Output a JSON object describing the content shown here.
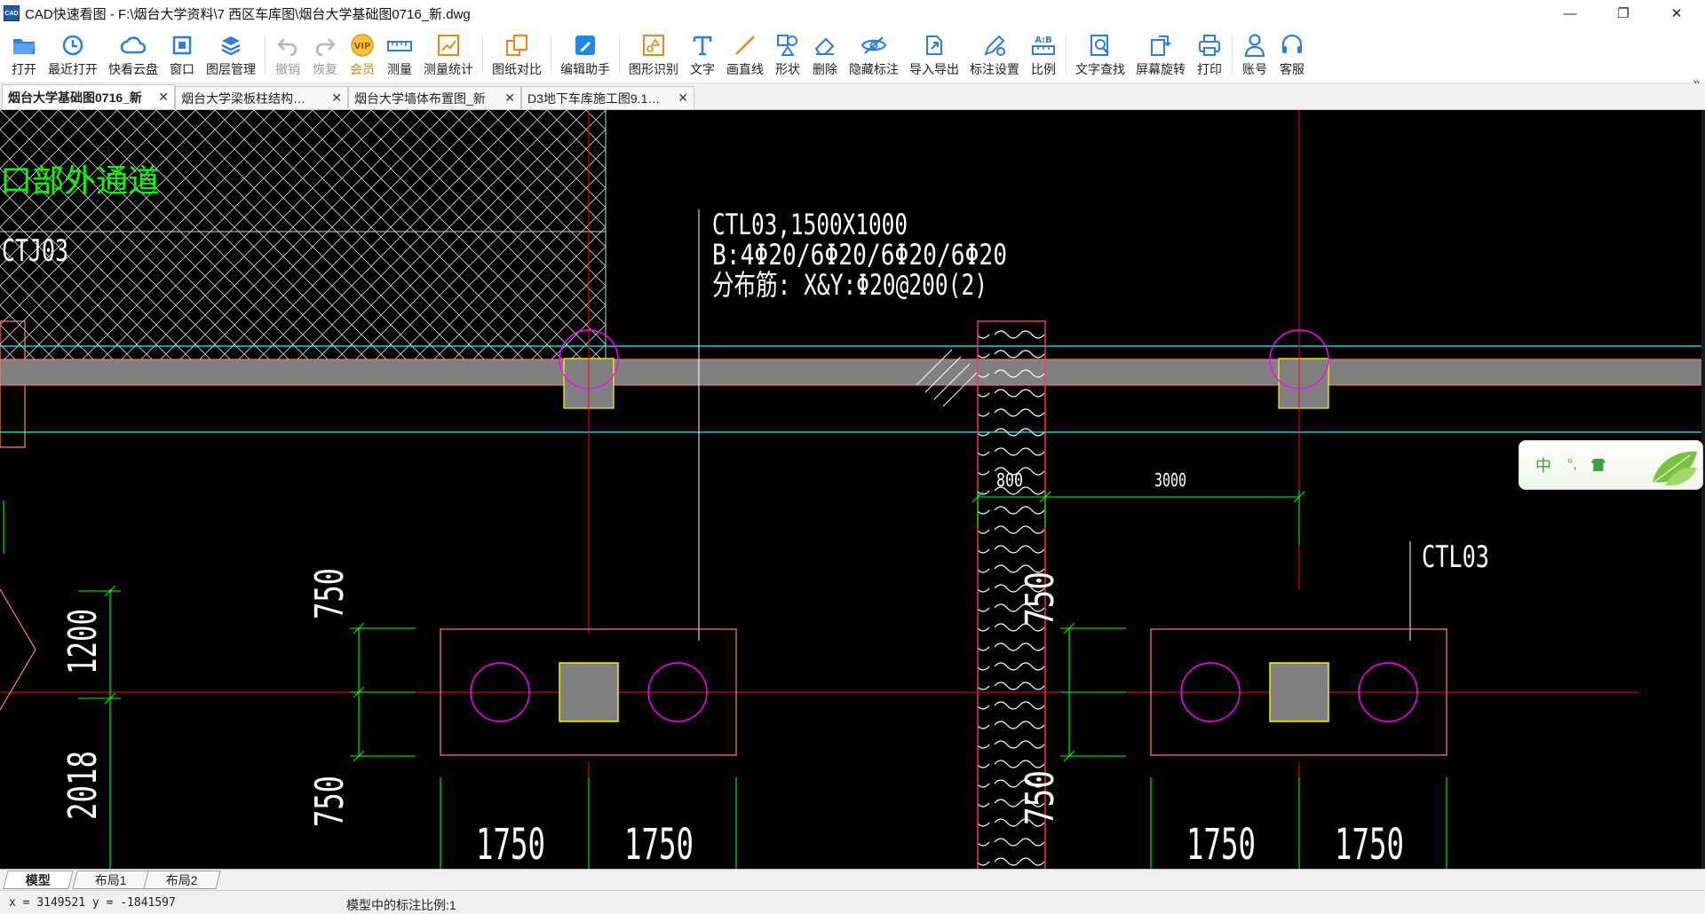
{
  "window": {
    "title": "CAD快速看图 - F:\\烟台大学资料\\7 西区车库图\\烟台大学基础图0716_新.dwg",
    "app_icon_text": "CAD",
    "minimize": "—",
    "restore": "❐",
    "close": "✕"
  },
  "toolbar": {
    "items": [
      {
        "label": "打开",
        "icon": "open-folder-icon"
      },
      {
        "label": "最近打开",
        "icon": "recent-clock-icon"
      },
      {
        "label": "快看云盘",
        "icon": "cloud-icon"
      },
      {
        "label": "窗口",
        "icon": "window-icon"
      },
      {
        "label": "图层管理",
        "icon": "layers-icon"
      },
      {
        "label": "撤销",
        "icon": "undo-icon"
      },
      {
        "label": "恢复",
        "icon": "redo-icon"
      },
      {
        "label": "会员",
        "icon": "vip-icon",
        "badge": "VIP"
      },
      {
        "label": "测量",
        "icon": "ruler-icon"
      },
      {
        "label": "测量统计",
        "icon": "measure-stats-icon"
      },
      {
        "label": "图纸对比",
        "icon": "compare-icon"
      },
      {
        "label": "编辑助手",
        "icon": "edit-assistant-icon"
      },
      {
        "label": "图形识别",
        "icon": "shape-recognize-icon"
      },
      {
        "label": "文字",
        "icon": "text-icon"
      },
      {
        "label": "画直线",
        "icon": "line-icon"
      },
      {
        "label": "形状",
        "icon": "shapes-icon"
      },
      {
        "label": "删除",
        "icon": "eraser-icon"
      },
      {
        "label": "隐藏标注",
        "icon": "hide-eye-icon"
      },
      {
        "label": "导入导出",
        "icon": "import-export-icon"
      },
      {
        "label": "标注设置",
        "icon": "annotation-settings-icon"
      },
      {
        "label": "比例",
        "icon": "scale-icon",
        "badge": "A:B"
      },
      {
        "label": "文字查找",
        "icon": "text-search-icon"
      },
      {
        "label": "屏幕旋转",
        "icon": "screen-rotate-icon"
      },
      {
        "label": "打印",
        "icon": "printer-icon"
      },
      {
        "label": "账号",
        "icon": "user-icon"
      },
      {
        "label": "客服",
        "icon": "headset-icon"
      }
    ],
    "more": "»"
  },
  "tabs": [
    {
      "name": "烟台大学基础图0716_新",
      "close": "✕"
    },
    {
      "name": "烟台大学梁板柱结构…",
      "close": "✕"
    },
    {
      "name": "烟台大学墙体布置图_新",
      "close": "✕"
    },
    {
      "name": "D3地下车库施工图9.1…",
      "close": "✕"
    }
  ],
  "drawing": {
    "label_channel": "口部外通道",
    "label_ctj": "CTJ03",
    "ann_line1": "CTL03,1500X1000",
    "ann_line2": "B:4Φ20/6Φ20/6Φ20/6Φ20",
    "ann_line3": "分布筋: X&Y:Φ20@200(2)",
    "label_ctl_right": "CTL03",
    "dim_800": "800",
    "dim_3000": "3000",
    "dim_750_left_top": "750",
    "dim_750_left_bottom": "750",
    "dim_1200": "1200",
    "dim_2018": "2018",
    "dim_1750_a": "1750",
    "dim_1750_b": "1750",
    "dim_1750_c": "1750",
    "dim_1750_d": "1750",
    "dim_750_mid_top": "750",
    "dim_750_mid_bottom": "750",
    "colors": {
      "background": "#000000",
      "axis_red": "#ff0000",
      "dimension_green": "#00ff00",
      "circle_magenta": "#ff00ff",
      "beam_gray": "#808080",
      "cyan_line": "#00ffff",
      "pile_cap_outline": "#ff8080",
      "column_fill": "#808080",
      "column_outline": "#ffff00",
      "text_white": "#ffffff"
    }
  },
  "layouts": {
    "model": "模型",
    "layout1": "布局1",
    "layout2": "布局2"
  },
  "status": {
    "coords": "x = 3149521  y = -1841597",
    "scale": "模型中的标注比例:1"
  },
  "ime": {
    "cn": "中",
    "punct": "°,"
  }
}
